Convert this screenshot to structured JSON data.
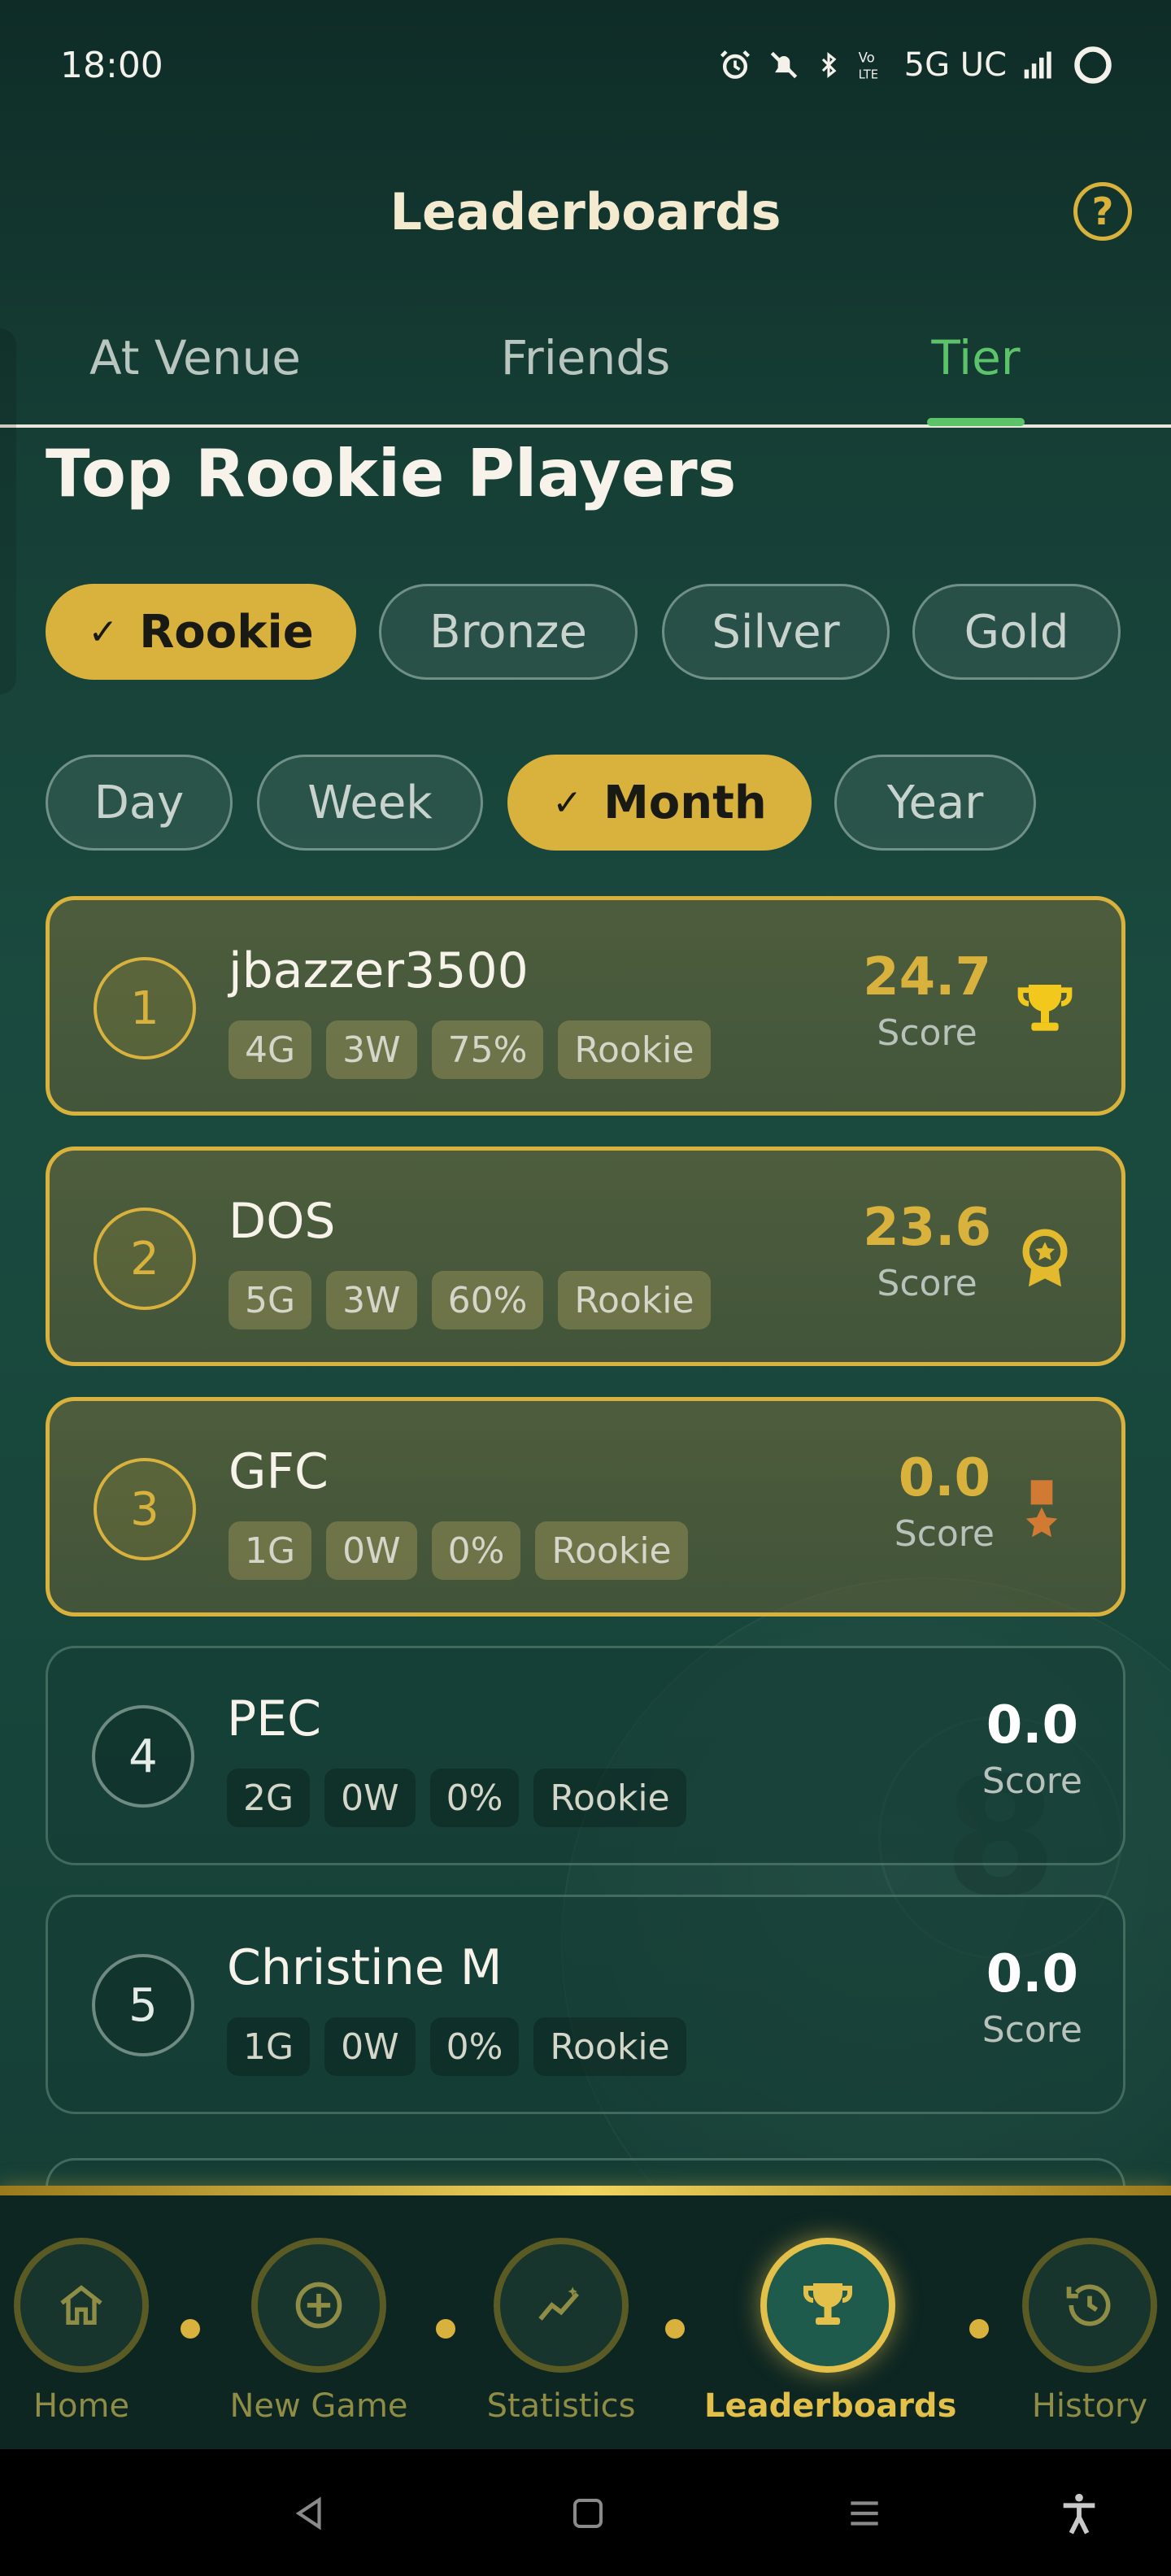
{
  "status_bar": {
    "time": "18:00",
    "network": "5G UC"
  },
  "header": {
    "title": "Leaderboards",
    "help_label": "?"
  },
  "tabs": [
    {
      "label": "At Venue",
      "active": false
    },
    {
      "label": "Friends",
      "active": false
    },
    {
      "label": "Tier",
      "active": true
    }
  ],
  "section_title": "Top Rookie Players",
  "tier_filters": [
    {
      "label": "Rookie",
      "selected": true
    },
    {
      "label": "Bronze",
      "selected": false
    },
    {
      "label": "Silver",
      "selected": false
    },
    {
      "label": "Gold",
      "selected": false
    }
  ],
  "period_filters": [
    {
      "label": "Day",
      "selected": false
    },
    {
      "label": "Week",
      "selected": false
    },
    {
      "label": "Month",
      "selected": true
    },
    {
      "label": "Year",
      "selected": false
    }
  ],
  "check_glyph": "✓",
  "score_label": "Score",
  "players": [
    {
      "rank": "1",
      "name": "jbazzer3500",
      "games": "4G",
      "wins": "3W",
      "win_pct": "75%",
      "tier": "Rookie",
      "score": "24.7",
      "award": "trophy-icon"
    },
    {
      "rank": "2",
      "name": "DOS",
      "games": "5G",
      "wins": "3W",
      "win_pct": "60%",
      "tier": "Rookie",
      "score": "23.6",
      "award": "medal-icon"
    },
    {
      "rank": "3",
      "name": "GFC",
      "games": "1G",
      "wins": "0W",
      "win_pct": "0%",
      "tier": "Rookie",
      "score": "0.0",
      "award": "ribbon-icon"
    },
    {
      "rank": "4",
      "name": "PEC",
      "games": "2G",
      "wins": "0W",
      "win_pct": "0%",
      "tier": "Rookie",
      "score": "0.0",
      "award": null
    },
    {
      "rank": "5",
      "name": "Christine M",
      "games": "1G",
      "wins": "0W",
      "win_pct": "0%",
      "tier": "Rookie",
      "score": "0.0",
      "award": null
    }
  ],
  "bottom_nav": [
    {
      "label": "Home",
      "icon": "home-icon",
      "active": false
    },
    {
      "label": "New Game",
      "icon": "plus-circle-icon",
      "active": false
    },
    {
      "label": "Statistics",
      "icon": "chart-icon",
      "active": false
    },
    {
      "label": "Leaderboards",
      "icon": "trophy-icon",
      "active": true
    },
    {
      "label": "History",
      "icon": "history-icon",
      "active": false
    }
  ],
  "colors": {
    "accent_gold": "#d8b23c",
    "active_tab_green": "#5cc36a",
    "background": "#1a4a3f"
  }
}
